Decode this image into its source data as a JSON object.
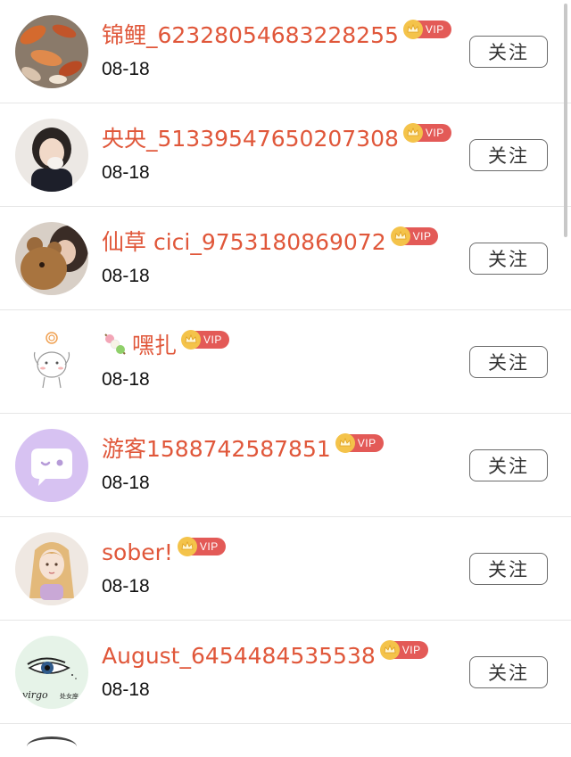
{
  "follow_label": "关注",
  "vip_label": "VIP",
  "users": [
    {
      "name": "锦鲤_62328054683228255",
      "date": "08-18",
      "vip": true,
      "avatar": "koi-fish-photo"
    },
    {
      "name": "央央_51339547650207308",
      "date": "08-18",
      "vip": true,
      "avatar": "girl-photo"
    },
    {
      "name": "仙草 cici_9753180869072",
      "date": "08-18",
      "vip": true,
      "avatar": "girl-with-teddy-bear-photo"
    },
    {
      "name": "嘿扎",
      "date": "08-18",
      "vip": true,
      "avatar": "cartoon-character",
      "prefix_emoji": "dango-icon"
    },
    {
      "name": "游客1588742587851",
      "date": "08-18",
      "vip": true,
      "avatar": "default-chat-avatar"
    },
    {
      "name": "sober!",
      "date": "08-18",
      "vip": true,
      "avatar": "illustrated-girl"
    },
    {
      "name": "August_6454484535538",
      "date": "08-18",
      "vip": true,
      "avatar": "eye-virgo",
      "avatar_text": [
        "virgo",
        "处女座"
      ]
    }
  ],
  "colors": {
    "name": "#e0573a",
    "vip_badge": "#e35a57",
    "crown": "#f4c34a",
    "divider": "#e6e6e6"
  }
}
